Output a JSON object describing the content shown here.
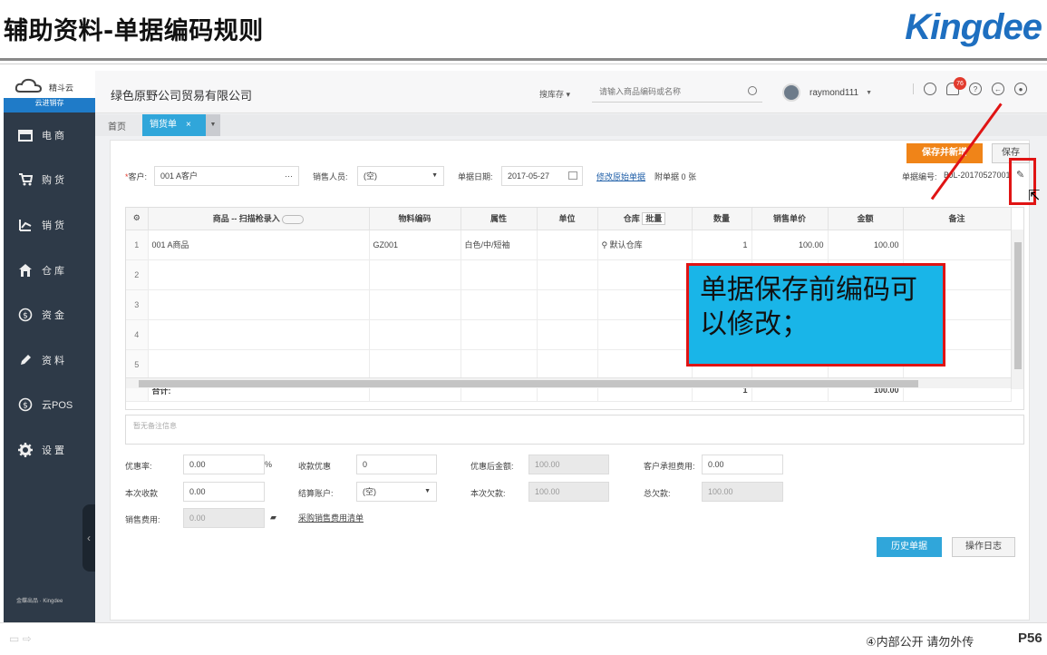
{
  "slide": {
    "title": "辅助资料-单据编码规则",
    "brand": "Kingdee",
    "footer_text": "④内部公开 请勿外传",
    "page": "P56"
  },
  "sidebar": {
    "brand_name": "精斗云",
    "brand_sub": "云进销存",
    "items": [
      {
        "label": "电 商",
        "icon": "shop-icon"
      },
      {
        "label": "购 货",
        "icon": "cart-icon"
      },
      {
        "label": "销 货",
        "icon": "sales-icon"
      },
      {
        "label": "仓 库",
        "icon": "warehouse-icon"
      },
      {
        "label": "资 金",
        "icon": "money-icon"
      },
      {
        "label": "资 料",
        "icon": "pencil-icon"
      },
      {
        "label": "云POS",
        "icon": "pos-icon"
      },
      {
        "label": "设 置",
        "icon": "gear-icon"
      }
    ],
    "collapse": "‹",
    "footer": "金蝶出品 · Kingdee"
  },
  "topbar": {
    "company": "绿色原野公司贸易有限公司",
    "search_scope": "搜库存",
    "search_placeholder": "请输入商品编码或名称",
    "username": "raymond111",
    "notif_count": "76"
  },
  "tabs": {
    "home": "首页",
    "active": "销货单",
    "close": "×",
    "more": "▼"
  },
  "form": {
    "save_new": "保存并新增",
    "save": "保存",
    "customer_label": "客户:",
    "customer_value": "001 A客户",
    "customer_more": "···",
    "salesperson_label": "销售人员:",
    "salesperson_value": "(空)",
    "date_label": "单据日期:",
    "date_value": "2017-05-27",
    "modify_link": "修改原始单据",
    "attach_label": "附单据",
    "attach_count": "0",
    "attach_unit": "张",
    "docno_label": "单据编号:",
    "docno_value": "BJL-20170527001"
  },
  "grid": {
    "headers": [
      "商品 -- 扫描枪录入",
      "物料编码",
      "属性",
      "单位",
      "仓库",
      "数量",
      "销售单价",
      "金额",
      "备注"
    ],
    "batch_label": "批量",
    "rows": [
      {
        "n": "1",
        "product": "001 A商品",
        "code": "GZ001",
        "attr": "白色/中/短袖",
        "unit": "",
        "warehouse": "默认仓库",
        "qty": "1",
        "price": "100.00",
        "amount": "100.00",
        "remark": ""
      },
      {
        "n": "2",
        "product": "",
        "code": "",
        "attr": "",
        "unit": "",
        "warehouse": "",
        "qty": "",
        "price": "",
        "amount": "",
        "remark": ""
      },
      {
        "n": "3",
        "product": "",
        "code": "",
        "attr": "",
        "unit": "",
        "warehouse": "",
        "qty": "",
        "price": "",
        "amount": "",
        "remark": ""
      },
      {
        "n": "4",
        "product": "",
        "code": "",
        "attr": "",
        "unit": "",
        "warehouse": "",
        "qty": "",
        "price": "",
        "amount": "",
        "remark": ""
      },
      {
        "n": "5",
        "product": "",
        "code": "",
        "attr": "",
        "unit": "",
        "warehouse": "",
        "qty": "",
        "price": "",
        "amount": "",
        "remark": ""
      }
    ],
    "total_label": "合计:",
    "total_qty": "1",
    "total_amount": "100.00"
  },
  "remark_placeholder": "暂无备注信息",
  "finance": {
    "discount_rate_label": "优惠率:",
    "discount_rate": "0.00",
    "percent": "%",
    "discount_amount_label": "收款优惠",
    "discount_amount": "0",
    "after_discount_label": "优惠后金额:",
    "after_discount": "100.00",
    "customer_fee_label": "客户承担费用:",
    "customer_fee": "0.00",
    "received_label": "本次收款",
    "received": "0.00",
    "account_label": "结算账户:",
    "account": "(空)",
    "owed_label": "本次欠款:",
    "owed": "100.00",
    "total_owed_label": "总欠款:",
    "total_owed": "100.00",
    "sales_fee_label": "销售费用:",
    "sales_fee": "0.00",
    "purchase_fee_link": "采购销售费用清单"
  },
  "buttons": {
    "history": "历史单据",
    "log": "操作日志"
  },
  "callout": {
    "text": "单据保存前编码可以修改；"
  },
  "colors": {
    "accent_blue": "#30a6da",
    "orange": "#f08418",
    "highlight_red": "#e01414",
    "callout_bg": "#19b5e8",
    "sidebar_bg": "#2e3a48"
  }
}
